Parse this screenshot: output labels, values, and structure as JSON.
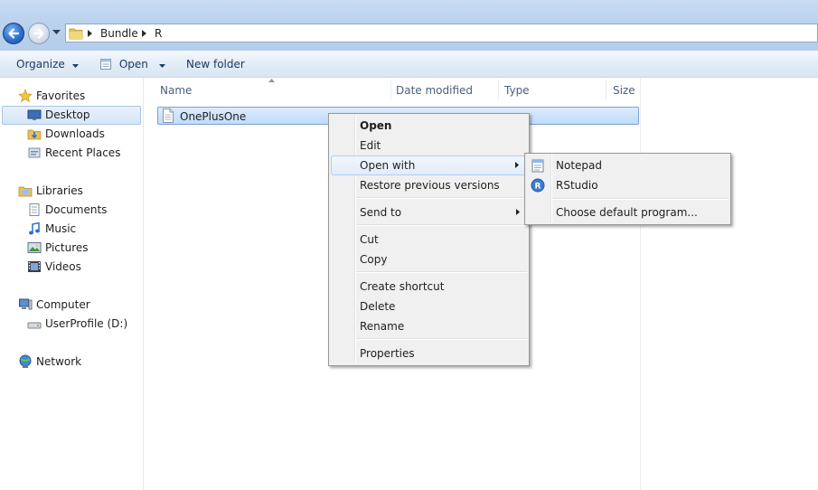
{
  "address": {
    "crumbs": [
      "Bundle",
      "R"
    ]
  },
  "toolbar": {
    "organize": "Organize",
    "open": "Open",
    "new_folder": "New folder"
  },
  "nav": {
    "favorites": "Favorites",
    "desktop": "Desktop",
    "downloads": "Downloads",
    "recent_places": "Recent Places",
    "libraries": "Libraries",
    "documents": "Documents",
    "music": "Music",
    "pictures": "Pictures",
    "videos": "Videos",
    "computer": "Computer",
    "userprofile": "UserProfile (D:)",
    "network": "Network"
  },
  "columns": {
    "name": "Name",
    "date_modified": "Date modified",
    "type": "Type",
    "size": "Size"
  },
  "files": [
    {
      "name": "OnePlusOne"
    }
  ],
  "context_menu": {
    "open": "Open",
    "edit": "Edit",
    "open_with": "Open with",
    "restore": "Restore previous versions",
    "send_to": "Send to",
    "cut": "Cut",
    "copy": "Copy",
    "create_shortcut": "Create shortcut",
    "delete": "Delete",
    "rename": "Rename",
    "properties": "Properties"
  },
  "open_with_menu": {
    "notepad": "Notepad",
    "rstudio": "RStudio",
    "choose_default": "Choose default program..."
  },
  "colors": {
    "selection": "#c1dcfc",
    "menu_bg": "#f0f0f0",
    "link_text": "#1e3a64"
  }
}
